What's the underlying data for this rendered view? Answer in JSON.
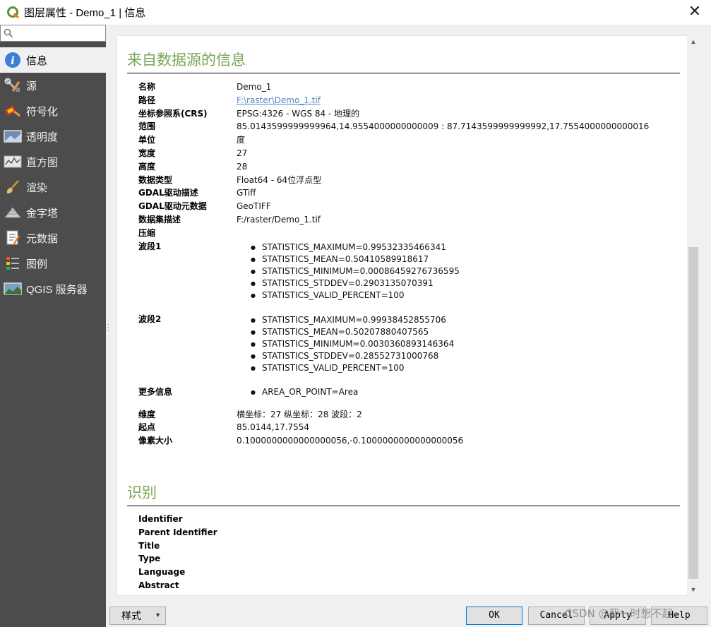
{
  "window": {
    "title": "图层属性 - Demo_1 | 信息",
    "close": "✕"
  },
  "search": {
    "placeholder": ""
  },
  "sidebar": {
    "items": [
      {
        "label": "信息",
        "icon": "info-icon",
        "active": true
      },
      {
        "label": "源",
        "icon": "source-tools-icon"
      },
      {
        "label": "符号化",
        "icon": "symbology-brush-icon"
      },
      {
        "label": "透明度",
        "icon": "transparency-icon"
      },
      {
        "label": "直方图",
        "icon": "histogram-icon"
      },
      {
        "label": "渲染",
        "icon": "rendering-brush-icon"
      },
      {
        "label": "金字塔",
        "icon": "pyramid-icon"
      },
      {
        "label": "元数据",
        "icon": "metadata-icon"
      },
      {
        "label": "图例",
        "icon": "legend-icon"
      },
      {
        "label": "QGIS 服务器",
        "icon": "qgis-server-icon"
      }
    ]
  },
  "info": {
    "title": "来自数据源的信息",
    "name_key": "名称",
    "name_val": "Demo_1",
    "path_key": "路径",
    "path_val": "F:\\raster\\Demo_1.tif",
    "crs_key": "坐标参照系(CRS)",
    "crs_val": "EPSG:4326 - WGS 84 - 地理的",
    "extent_key": "范围",
    "extent_val": "85.0143599999999964,14.9554000000000009 : 87.7143599999999992,17.7554000000000016",
    "unit_key": "单位",
    "unit_val": "度",
    "width_key": "宽度",
    "width_val": "27",
    "height_key": "高度",
    "height_val": "28",
    "dtype_key": "数据类型",
    "dtype_val": "Float64 - 64位浮点型",
    "gdal_desc_key": "GDAL驱动描述",
    "gdal_desc_val": "GTiff",
    "gdal_meta_key": "GDAL驱动元数据",
    "gdal_meta_val": "GeoTIFF",
    "dataset_key": "数据集描述",
    "dataset_val": "F:/raster/Demo_1.tif",
    "compress_key": "压缩",
    "compress_val": "",
    "band1_key": "波段1",
    "band1": [
      "STATISTICS_MAXIMUM=0.99532335466341",
      "STATISTICS_MEAN=0.50410589918617",
      "STATISTICS_MINIMUM=0.00086459276736595",
      "STATISTICS_STDDEV=0.2903135070391",
      "STATISTICS_VALID_PERCENT=100"
    ],
    "band2_key": "波段2",
    "band2": [
      "STATISTICS_MAXIMUM=0.99938452855706",
      "STATISTICS_MEAN=0.50207880407565",
      "STATISTICS_MINIMUM=0.0030360893146364",
      "STATISTICS_STDDEV=0.28552731000768",
      "STATISTICS_VALID_PERCENT=100"
    ],
    "more_key": "更多信息",
    "more": [
      "AREA_OR_POINT=Area"
    ],
    "dims_key": "维度",
    "dims_val": "横坐标：27 纵坐标：28 波段：2",
    "origin_key": "起点",
    "origin_val": "85.0144,17.7554",
    "pixel_key": "像素大小",
    "pixel_val": "0.1000000000000000056,-0.1000000000000000056"
  },
  "ident": {
    "title": "识别",
    "identifier": "Identifier",
    "parent_identifier": "Parent Identifier",
    "title_field": "Title",
    "type": "Type",
    "language": "Language",
    "abstract": "Abstract"
  },
  "buttons": {
    "style": "样式",
    "ok": "OK",
    "cancel": "Cancel",
    "apply": "Apply",
    "help": "Help"
  },
  "watermark": "CSDN @我一时想不起",
  "colors": {
    "section_title": "#7aa657",
    "sidebar_bg": "#4c4c4c",
    "link": "#5b86c5"
  }
}
